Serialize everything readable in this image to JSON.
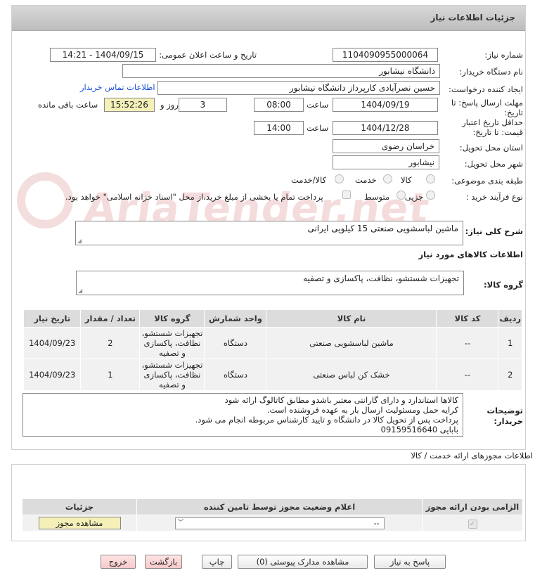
{
  "panel_title": "جزئیات اطلاعات نیاز",
  "fields": {
    "need_number_label": "شماره نیاز:",
    "need_number": "1104090955000064",
    "announce_label": "تاریخ و ساعت اعلان عمومی:",
    "announce_value": "1404/09/15 - 14:21",
    "buyer_label": "نام دستگاه خریدار:",
    "buyer": "دانشگاه نیشابور",
    "creator_label": "ایجاد کننده درخواست:",
    "creator": "حسین نصرآبادی کارپرداز دانشگاه نیشابور",
    "contact_link": "اطلاعات تماس خریدار",
    "deadline_label_1": "مهلت ارسال پاسخ: تا",
    "deadline_label_2": "تاریخ:",
    "deadline_date": "1404/09/19",
    "time_label": "ساعت",
    "deadline_time": "08:00",
    "days_value": "3",
    "days_label": "روز و",
    "remaining_time": "15:52:26",
    "remaining_label": "ساعت باقی مانده",
    "validity_label_1": "حداقل تاریخ اعتبار",
    "validity_label_2": "قیمت: تا تاریخ:",
    "validity_date": "1404/12/28",
    "validity_time_label": "ساعت",
    "validity_time": "14:00",
    "province_label": "استان محل تحویل:",
    "province": "خراسان رضوی",
    "city_label": "شهر محل تحویل:",
    "city": "نیشابور",
    "category_label": "طبقه بندی موضوعی:",
    "category_options": [
      "کالا",
      "خدمت",
      "کالا/خدمت"
    ],
    "process_label": "نوع فرآیند خرید :",
    "process_options": [
      "جزیی",
      "متوسط"
    ],
    "payment_note": "پرداخت تمام یا بخشی از مبلغ خرید،از محل \"اسناد خزانه اسلامی\" خواهد بود.",
    "summary_label": "شرح کلی نیاز:",
    "summary": "ماشین لباسشویی صنعتی 15  کیلویی ایرانی",
    "goods_info_title": "اطلاعات کالاهای مورد نیاز",
    "goods_group_label": "گروه کالا:",
    "goods_group": "تجهیزات شستشو، نظافت، پاکسازی و تصفیه"
  },
  "watermark": "AriaTender.net",
  "items_table": {
    "headers": [
      "ردیف",
      "کد کالا",
      "نام کالا",
      "واحد شمارش",
      "گروه کالا",
      "تعداد / مقدار",
      "تاریخ نیاز"
    ],
    "rows": [
      {
        "row": "1",
        "code": "--",
        "name": "ماشین لباسشویی صنعتی",
        "unit": "دستگاه",
        "group": "تجهیزات شستشو، نظافت، پاکسازی و تصفیه",
        "qty": "2",
        "date": "1404/09/23"
      },
      {
        "row": "2",
        "code": "--",
        "name": "خشک کن لباس صنعتی",
        "unit": "دستگاه",
        "group": "تجهیزات شستشو، نظافت، پاکسازی و تصفیه",
        "qty": "1",
        "date": "1404/09/23"
      }
    ]
  },
  "buyer_notes_label": "توضیحات خریدار:",
  "buyer_notes": [
    "کالاها استاندارد و دارای گارانتی معتبر باشدو مطابق کاتالوگ ارائه شود",
    "کرایه حمل ومسئولیت ارسال بار به عهده فروشنده است.",
    "پرداخت پس از تحویل کالا در دانشگاه و تایید کارشناس مربوطه انجام می شود.",
    "بابایی 09159516640"
  ],
  "licenses": {
    "title": "اطلاعات مجوزهای ارائه خدمت / کالا",
    "headers": [
      "الزامی بودن ارائه مجوز",
      "اعلام وضعیت مجوز توسط تامین کننده",
      "جزئیات"
    ],
    "select_value": "--",
    "view_button": "مشاهده مجوز"
  },
  "buttons": {
    "reply": "پاسخ به نیاز",
    "docs": "مشاهده مدارک پیوستی (0)",
    "print": "چاپ",
    "back": "بازگشت",
    "exit": "خروج"
  }
}
